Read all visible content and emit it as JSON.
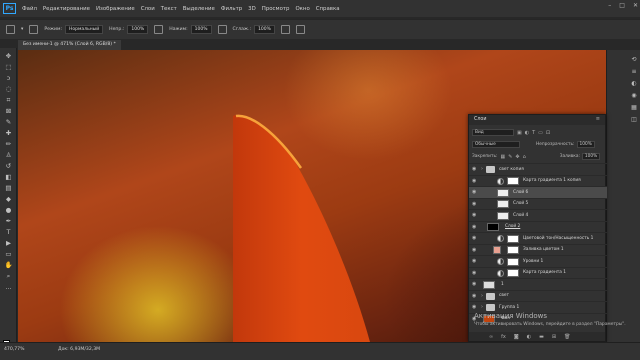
{
  "menubar": {
    "logo": "Ps",
    "items": [
      "Файл",
      "Редактирование",
      "Изображение",
      "Слои",
      "Текст",
      "Выделение",
      "Фильтр",
      "3D",
      "Просмотр",
      "Окно",
      "Справка"
    ],
    "controls": [
      "–",
      "□",
      "✕"
    ]
  },
  "options": {
    "mode_label": "Режим:",
    "mode_value": "Нормальный",
    "opacity_label": "Непр.:",
    "opacity_value": "100%",
    "flow_label": "Нажим:",
    "flow_value": "100%",
    "smoothing_label": "Сглаж.:",
    "smoothing_value": "100%"
  },
  "document": {
    "tab_title": "Без имени-1 @ 471% (Слой 6, RGB/8) *"
  },
  "status": {
    "zoom": "470,77%",
    "doc_size": "Док: 6,93M/32,3M"
  },
  "layers_panel": {
    "title": "Слои",
    "filter_kind": "Вид",
    "blend_mode": "Обычные",
    "opacity_label": "Непрозрачность:",
    "opacity_value": "100%",
    "lock_label": "Закрепить:",
    "fill_label": "Заливка:",
    "fill_value": "100%",
    "layers": [
      {
        "name": "свет копия",
        "type": "group"
      },
      {
        "name": "Карта градиента 1 копия",
        "type": "adjustment"
      },
      {
        "name": "Слой 6",
        "type": "pixel",
        "selected": true
      },
      {
        "name": "Слой 5",
        "type": "pixel"
      },
      {
        "name": "Слой 4",
        "type": "pixel"
      },
      {
        "name": "Слой 2",
        "type": "pixel"
      },
      {
        "name": "Цветовой тон/Насыщенность 1",
        "type": "adjustment"
      },
      {
        "name": "Заливка цветом 1",
        "type": "fill"
      },
      {
        "name": "Уровни 1",
        "type": "adjustment"
      },
      {
        "name": "Карта градиента 1",
        "type": "adjustment"
      },
      {
        "name": "1",
        "type": "pixel"
      },
      {
        "name": "свет",
        "type": "group"
      },
      {
        "name": "Группа 1",
        "type": "group"
      },
      {
        "name": "Фон",
        "type": "pixel"
      }
    ]
  },
  "watermark": {
    "title": "Активация Windows",
    "subtitle": "Чтобы активировать Windows, перейдите в раздел \"Параметры\"."
  },
  "colors": {
    "accent": "#31a8ff",
    "panel_bg": "#323232",
    "petal": "#e04a10",
    "fill_layer_swatch": "#e8a090"
  }
}
